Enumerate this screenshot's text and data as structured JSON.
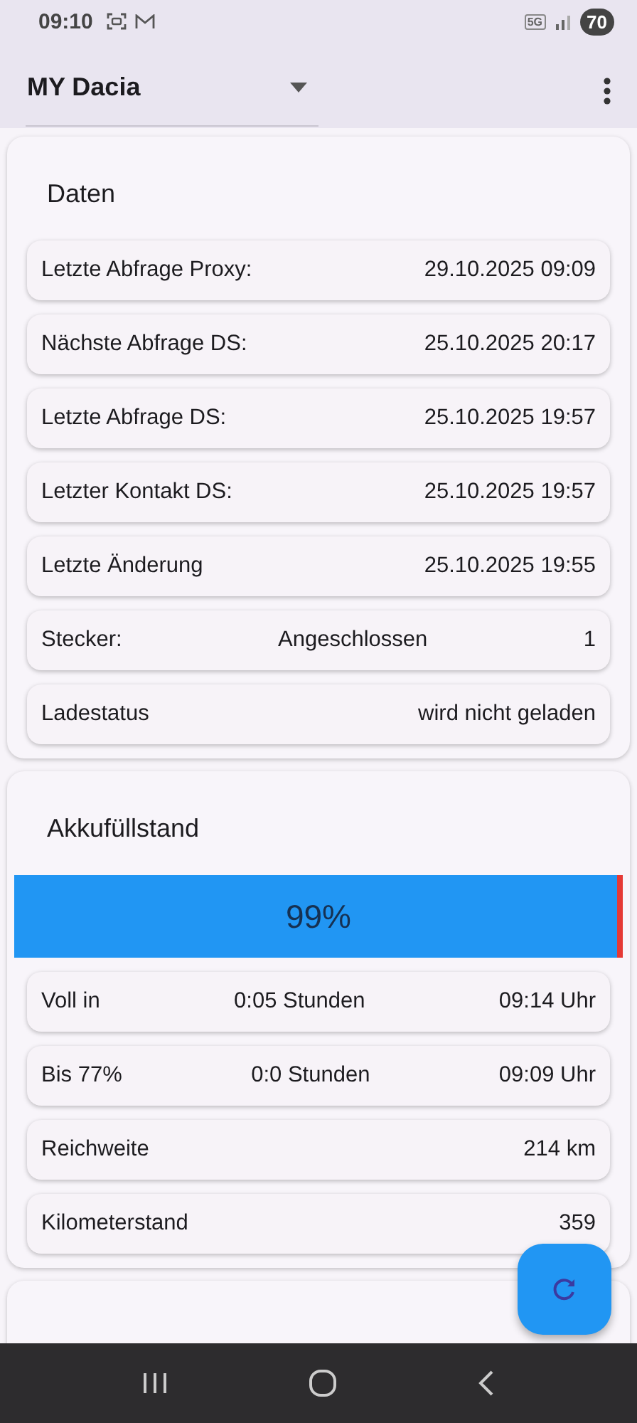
{
  "status_bar": {
    "time": "09:10",
    "battery": "70",
    "network": "5G"
  },
  "app_bar": {
    "vehicle": "MY Dacia"
  },
  "cards": [
    {
      "title": "Daten",
      "rows": [
        {
          "label": "Letzte Abfrage Proxy:",
          "value": "29.10.2025 09:09"
        },
        {
          "label": "Nächste Abfrage DS:",
          "value": "25.10.2025 20:17"
        },
        {
          "label": "Letzte Abfrage DS:",
          "value": "25.10.2025 19:57"
        },
        {
          "label": "Letzter Kontakt DS:",
          "value": "25.10.2025 19:57"
        },
        {
          "label": "Letzte Änderung",
          "value": "25.10.2025 19:55"
        },
        {
          "label": "Stecker:",
          "middle": "Angeschlossen",
          "value": "1"
        },
        {
          "label": "Ladestatus",
          "value": "wird nicht geladen"
        }
      ]
    },
    {
      "title": "Akkufüllstand",
      "battery": {
        "level": 0.99,
        "reading": "99%"
      },
      "rows": [
        {
          "label": "Voll in",
          "middle": "0:05 Stunden",
          "value": "09:14 Uhr"
        },
        {
          "label": "Bis 77%",
          "middle": "0:0 Stunden",
          "value": "09:09 Uhr"
        },
        {
          "label": "Reichweite",
          "value": "214 km"
        },
        {
          "label": "Kilometerstand",
          "value": "359"
        }
      ]
    }
  ]
}
